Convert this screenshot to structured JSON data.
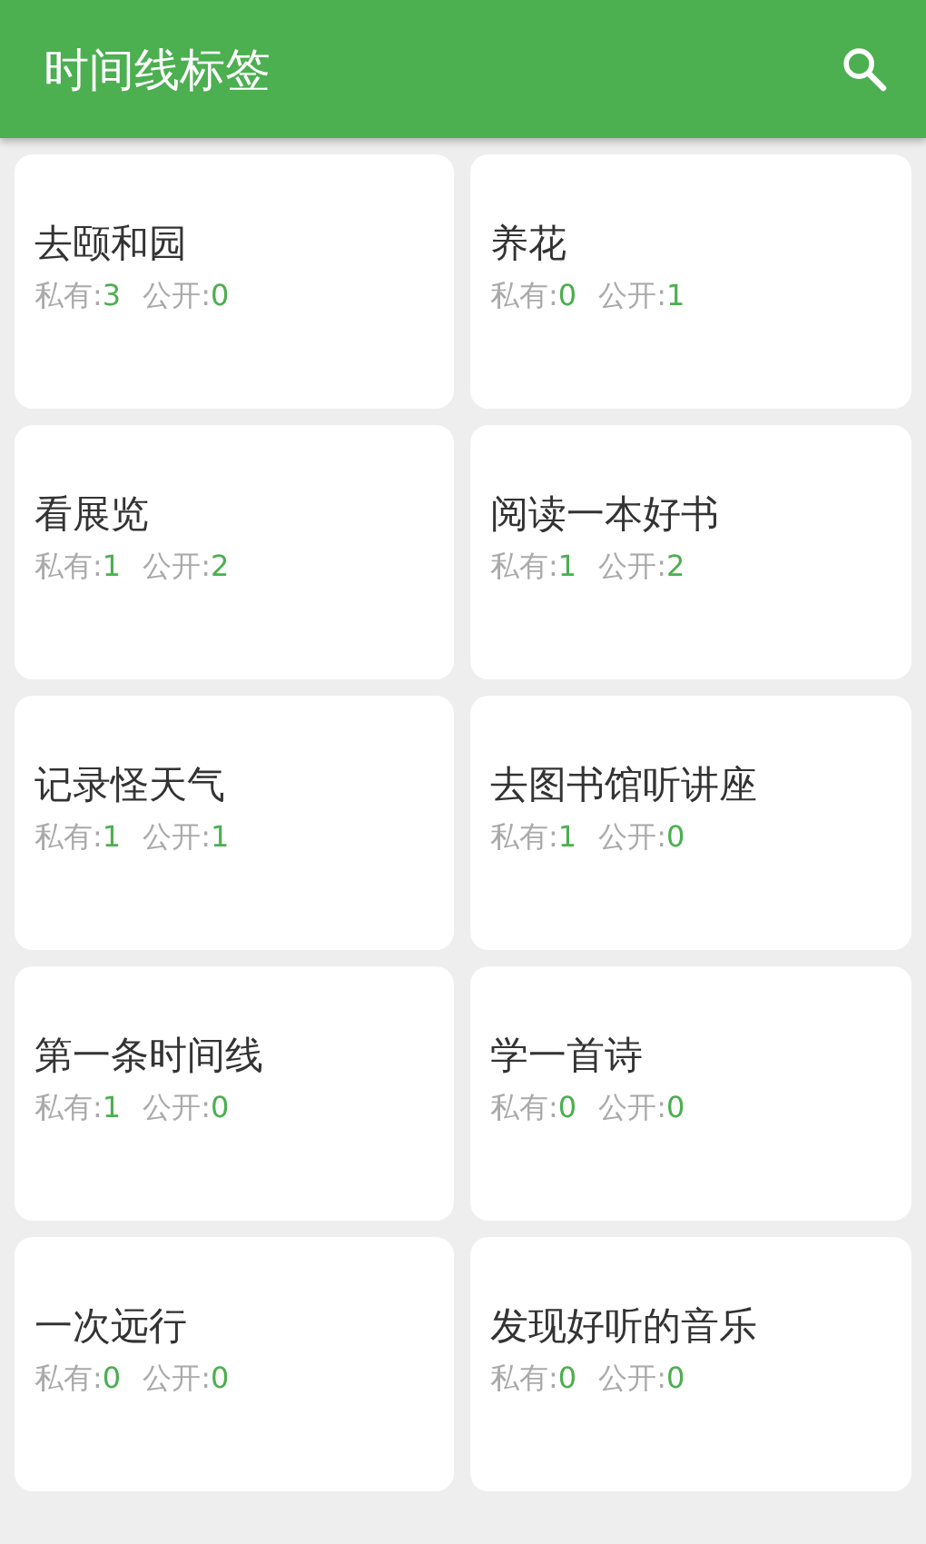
{
  "app_bar": {
    "title": "时间线标签"
  },
  "tags": [
    {
      "name": "去颐和园",
      "private_label": "私有:",
      "private_count": "3",
      "public_label": "公开:",
      "public_count": "0"
    },
    {
      "name": "养花",
      "private_label": "私有:",
      "private_count": "0",
      "public_label": "公开:",
      "public_count": "1"
    },
    {
      "name": "看展览",
      "private_label": "私有:",
      "private_count": "1",
      "public_label": "公开:",
      "public_count": "2"
    },
    {
      "name": "阅读一本好书",
      "private_label": "私有:",
      "private_count": "1",
      "public_label": "公开:",
      "public_count": "2"
    },
    {
      "name": "记录怪天气",
      "private_label": "私有:",
      "private_count": "1",
      "public_label": "公开:",
      "public_count": "1"
    },
    {
      "name": "去图书馆听讲座",
      "private_label": "私有:",
      "private_count": "1",
      "public_label": "公开:",
      "public_count": "0"
    },
    {
      "name": "第一条时间线",
      "private_label": "私有:",
      "private_count": "1",
      "public_label": "公开:",
      "public_count": "0"
    },
    {
      "name": "学一首诗",
      "private_label": "私有:",
      "private_count": "0",
      "public_label": "公开:",
      "public_count": "0"
    },
    {
      "name": "一次远行",
      "private_label": "私有:",
      "private_count": "0",
      "public_label": "公开:",
      "public_count": "0"
    },
    {
      "name": "发现好听的音乐",
      "private_label": "私有:",
      "private_count": "0",
      "public_label": "公开:",
      "public_count": "0"
    }
  ]
}
